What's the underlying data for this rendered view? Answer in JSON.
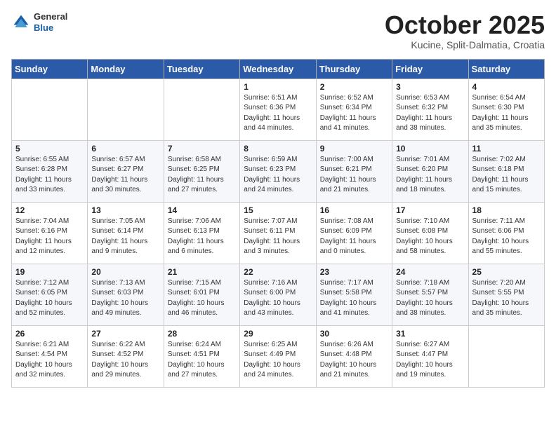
{
  "header": {
    "logo": {
      "general": "General",
      "blue": "Blue"
    },
    "title": "October 2025",
    "location": "Kucine, Split-Dalmatia, Croatia"
  },
  "weekdays": [
    "Sunday",
    "Monday",
    "Tuesday",
    "Wednesday",
    "Thursday",
    "Friday",
    "Saturday"
  ],
  "weeks": [
    [
      {
        "day": "",
        "info": ""
      },
      {
        "day": "",
        "info": ""
      },
      {
        "day": "",
        "info": ""
      },
      {
        "day": "1",
        "info": "Sunrise: 6:51 AM\nSunset: 6:36 PM\nDaylight: 11 hours\nand 44 minutes."
      },
      {
        "day": "2",
        "info": "Sunrise: 6:52 AM\nSunset: 6:34 PM\nDaylight: 11 hours\nand 41 minutes."
      },
      {
        "day": "3",
        "info": "Sunrise: 6:53 AM\nSunset: 6:32 PM\nDaylight: 11 hours\nand 38 minutes."
      },
      {
        "day": "4",
        "info": "Sunrise: 6:54 AM\nSunset: 6:30 PM\nDaylight: 11 hours\nand 35 minutes."
      }
    ],
    [
      {
        "day": "5",
        "info": "Sunrise: 6:55 AM\nSunset: 6:28 PM\nDaylight: 11 hours\nand 33 minutes."
      },
      {
        "day": "6",
        "info": "Sunrise: 6:57 AM\nSunset: 6:27 PM\nDaylight: 11 hours\nand 30 minutes."
      },
      {
        "day": "7",
        "info": "Sunrise: 6:58 AM\nSunset: 6:25 PM\nDaylight: 11 hours\nand 27 minutes."
      },
      {
        "day": "8",
        "info": "Sunrise: 6:59 AM\nSunset: 6:23 PM\nDaylight: 11 hours\nand 24 minutes."
      },
      {
        "day": "9",
        "info": "Sunrise: 7:00 AM\nSunset: 6:21 PM\nDaylight: 11 hours\nand 21 minutes."
      },
      {
        "day": "10",
        "info": "Sunrise: 7:01 AM\nSunset: 6:20 PM\nDaylight: 11 hours\nand 18 minutes."
      },
      {
        "day": "11",
        "info": "Sunrise: 7:02 AM\nSunset: 6:18 PM\nDaylight: 11 hours\nand 15 minutes."
      }
    ],
    [
      {
        "day": "12",
        "info": "Sunrise: 7:04 AM\nSunset: 6:16 PM\nDaylight: 11 hours\nand 12 minutes."
      },
      {
        "day": "13",
        "info": "Sunrise: 7:05 AM\nSunset: 6:14 PM\nDaylight: 11 hours\nand 9 minutes."
      },
      {
        "day": "14",
        "info": "Sunrise: 7:06 AM\nSunset: 6:13 PM\nDaylight: 11 hours\nand 6 minutes."
      },
      {
        "day": "15",
        "info": "Sunrise: 7:07 AM\nSunset: 6:11 PM\nDaylight: 11 hours\nand 3 minutes."
      },
      {
        "day": "16",
        "info": "Sunrise: 7:08 AM\nSunset: 6:09 PM\nDaylight: 11 hours\nand 0 minutes."
      },
      {
        "day": "17",
        "info": "Sunrise: 7:10 AM\nSunset: 6:08 PM\nDaylight: 10 hours\nand 58 minutes."
      },
      {
        "day": "18",
        "info": "Sunrise: 7:11 AM\nSunset: 6:06 PM\nDaylight: 10 hours\nand 55 minutes."
      }
    ],
    [
      {
        "day": "19",
        "info": "Sunrise: 7:12 AM\nSunset: 6:05 PM\nDaylight: 10 hours\nand 52 minutes."
      },
      {
        "day": "20",
        "info": "Sunrise: 7:13 AM\nSunset: 6:03 PM\nDaylight: 10 hours\nand 49 minutes."
      },
      {
        "day": "21",
        "info": "Sunrise: 7:15 AM\nSunset: 6:01 PM\nDaylight: 10 hours\nand 46 minutes."
      },
      {
        "day": "22",
        "info": "Sunrise: 7:16 AM\nSunset: 6:00 PM\nDaylight: 10 hours\nand 43 minutes."
      },
      {
        "day": "23",
        "info": "Sunrise: 7:17 AM\nSunset: 5:58 PM\nDaylight: 10 hours\nand 41 minutes."
      },
      {
        "day": "24",
        "info": "Sunrise: 7:18 AM\nSunset: 5:57 PM\nDaylight: 10 hours\nand 38 minutes."
      },
      {
        "day": "25",
        "info": "Sunrise: 7:20 AM\nSunset: 5:55 PM\nDaylight: 10 hours\nand 35 minutes."
      }
    ],
    [
      {
        "day": "26",
        "info": "Sunrise: 6:21 AM\nSunset: 4:54 PM\nDaylight: 10 hours\nand 32 minutes."
      },
      {
        "day": "27",
        "info": "Sunrise: 6:22 AM\nSunset: 4:52 PM\nDaylight: 10 hours\nand 29 minutes."
      },
      {
        "day": "28",
        "info": "Sunrise: 6:24 AM\nSunset: 4:51 PM\nDaylight: 10 hours\nand 27 minutes."
      },
      {
        "day": "29",
        "info": "Sunrise: 6:25 AM\nSunset: 4:49 PM\nDaylight: 10 hours\nand 24 minutes."
      },
      {
        "day": "30",
        "info": "Sunrise: 6:26 AM\nSunset: 4:48 PM\nDaylight: 10 hours\nand 21 minutes."
      },
      {
        "day": "31",
        "info": "Sunrise: 6:27 AM\nSunset: 4:47 PM\nDaylight: 10 hours\nand 19 minutes."
      },
      {
        "day": "",
        "info": ""
      }
    ]
  ]
}
